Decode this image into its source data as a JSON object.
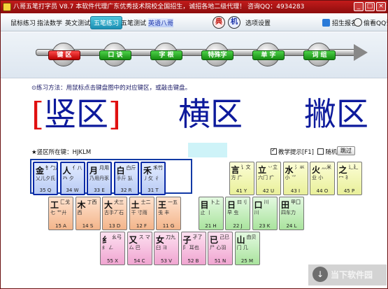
{
  "window": {
    "title": "八哥五笔打字员 V8.7    本软件代理广东优秀技术院校全国招生，诚招各地二级代理！ 咨询QQ：4934283",
    "controls": {
      "minimize": "_",
      "maximize": "□",
      "close": "×"
    }
  },
  "menu": {
    "items": [
      "鼠标练习",
      "指法数学",
      "英文测试",
      "五笔练习",
      "五笔测试",
      "英语八哥"
    ],
    "active_index": 3,
    "btn_red": "典",
    "btn_blue": "机",
    "settings": "选项设置",
    "register": "招生报名",
    "records": "偷看QQ记录"
  },
  "steps": {
    "items": [
      "键 区",
      "口 诀",
      "字 根",
      "特殊字",
      "单 字",
      "词 组"
    ],
    "current_index": 0
  },
  "practice": {
    "instruction": "⊙练习方法：用鼠标点击键盘图中的对应键区，或敲击键盘。",
    "zone_current": "竖区",
    "bracket_left": "[",
    "bracket_right": "]",
    "zone_next": "横区",
    "zone_next2": "撇区",
    "keys_label": "★竖区所在键：HJKLM",
    "hint_label": "教学提示[F1]",
    "random_label": "随机",
    "hint_checked": true,
    "random_checked": false,
    "skip_label": "跳过"
  },
  "keyboard": {
    "rows": [
      [
        {
          "char": "金",
          "roots": "钅勹儿",
          "roots2": "乂儿夕氏",
          "code": "35 Q",
          "color": "blue"
        },
        {
          "char": "人",
          "roots": "亻八",
          "roots2": "癶 夕",
          "code": "34 W",
          "color": "blue"
        },
        {
          "char": "月",
          "roots": "月用",
          "roots2": "乃用丹豕",
          "code": "33 E",
          "color": "blue"
        },
        {
          "char": "白",
          "roots": "白斤",
          "roots2": "手斤 㫃",
          "code": "32 R",
          "color": "blue"
        },
        {
          "char": "禾",
          "roots": "禾竹",
          "roots2": "丿攵 彳",
          "code": "31 T",
          "color": "blue"
        },
        {
          "char": "言",
          "roots": "讠文",
          "roots2": "方 广",
          "code": "41 Y",
          "color": "yellow"
        },
        {
          "char": "立",
          "roots": "丷立",
          "roots2": "六门 疒",
          "code": "42 U",
          "color": "yellow"
        },
        {
          "char": "水",
          "roots": "氵氺",
          "roots2": "小 ⺌",
          "code": "43 I",
          "color": "yellow"
        },
        {
          "char": "火",
          "roots": "灬米",
          "roots2": "业 小",
          "code": "44 O",
          "color": "yellow"
        },
        {
          "char": "之",
          "roots": "辶廴",
          "roots2": "冖 礻",
          "code": "45 P",
          "color": "yellow"
        }
      ],
      [
        {
          "char": "工",
          "roots": "匚戈",
          "roots2": "七 艹廾",
          "code": "15 A",
          "color": "orange"
        },
        {
          "char": "木",
          "roots": "丁西",
          "roots2": "西",
          "code": "14 S",
          "color": "orange"
        },
        {
          "char": "大",
          "roots": "犬三",
          "roots2": "古手丆石",
          "code": "13 D",
          "color": "orange"
        },
        {
          "char": "土",
          "roots": "士二",
          "roots2": "干 寸雨",
          "code": "12 F",
          "color": "orange"
        },
        {
          "char": "王",
          "roots": "一五",
          "roots2": "戋 丰",
          "code": "11 G",
          "color": "orange"
        },
        {
          "char": "目",
          "roots": "卜上",
          "roots2": "止 丨",
          "code": "21 H",
          "color": "green"
        },
        {
          "char": "日",
          "roots": "曰刂",
          "roots2": "早 虫",
          "code": "22 J",
          "color": "green"
        },
        {
          "char": "口",
          "roots": "川",
          "roots2": "川",
          "code": "23 K",
          "color": "green"
        },
        {
          "char": "田",
          "roots": "甲囗",
          "roots2": "四车力",
          "code": "24 L",
          "color": "green"
        }
      ],
      [
        {
          "char": "纟",
          "roots": "幺弓",
          "roots2": "纟 ㄥ",
          "code": "55 X",
          "color": "pink"
        },
        {
          "char": "又",
          "roots": "ス マ",
          "roots2": "厶 巴",
          "code": "54 C",
          "color": "pink"
        },
        {
          "char": "女",
          "roots": "刀九",
          "roots2": "臼 ヨ",
          "code": "53 V",
          "color": "pink"
        },
        {
          "char": "子",
          "roots": "孑了",
          "roots2": "阝 耳也",
          "code": "52 B",
          "color": "pink"
        },
        {
          "char": "已",
          "roots": "己巳",
          "roots2": "尸 心羽",
          "code": "51 N",
          "color": "pink"
        },
        {
          "char": "山",
          "roots": "由贝",
          "roots2": "门 几",
          "code": "25 M",
          "color": "green"
        }
      ]
    ]
  },
  "watermark": "当下软件园"
}
